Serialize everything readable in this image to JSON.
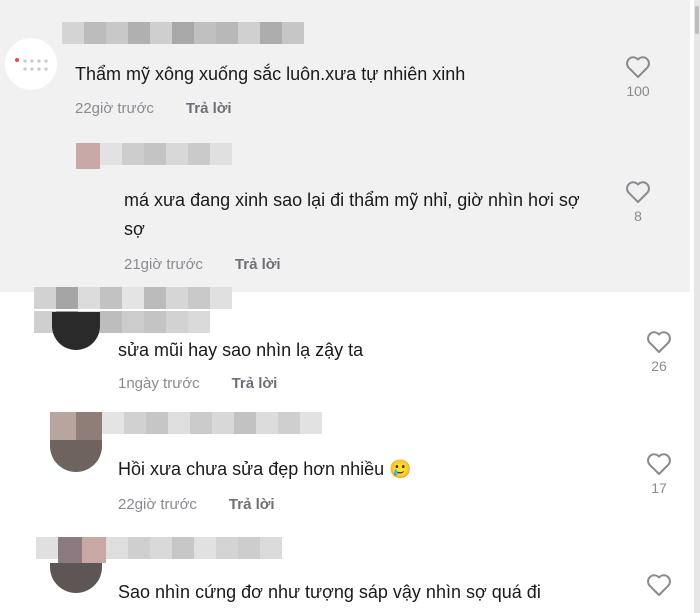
{
  "comments": [
    {
      "text": "Thẩm mỹ xông xuống sắc luôn.xưa tự nhiên xinh",
      "time": "22giờ trước",
      "reply": "Trả lời",
      "likes": "100"
    },
    {
      "text": "má xưa đang xinh sao lại đi thẩm mỹ nhỉ, giờ nhìn hơi sợ sợ",
      "time": "21giờ trước",
      "reply": "Trả lời",
      "likes": "8"
    },
    {
      "text": "sửa mũi hay sao nhìn lạ zậy ta",
      "time": "1ngày trước",
      "reply": "Trả lời",
      "likes": "26"
    },
    {
      "text": "Hồi xưa chưa sửa đẹp hơn nhiều 🥲",
      "time": "22giờ trước",
      "reply": "Trả lời",
      "likes": "17"
    },
    {
      "text": "Sao nhìn cứng đơ như tượng sáp vậy nhìn sợ quá đi",
      "time": "",
      "reply": "",
      "likes": ""
    }
  ],
  "icons": {
    "like": "heart-outline-icon"
  },
  "colors": {
    "panel": "#f1f1f2",
    "meta": "#8a8b91",
    "reply": "#6f7077"
  }
}
